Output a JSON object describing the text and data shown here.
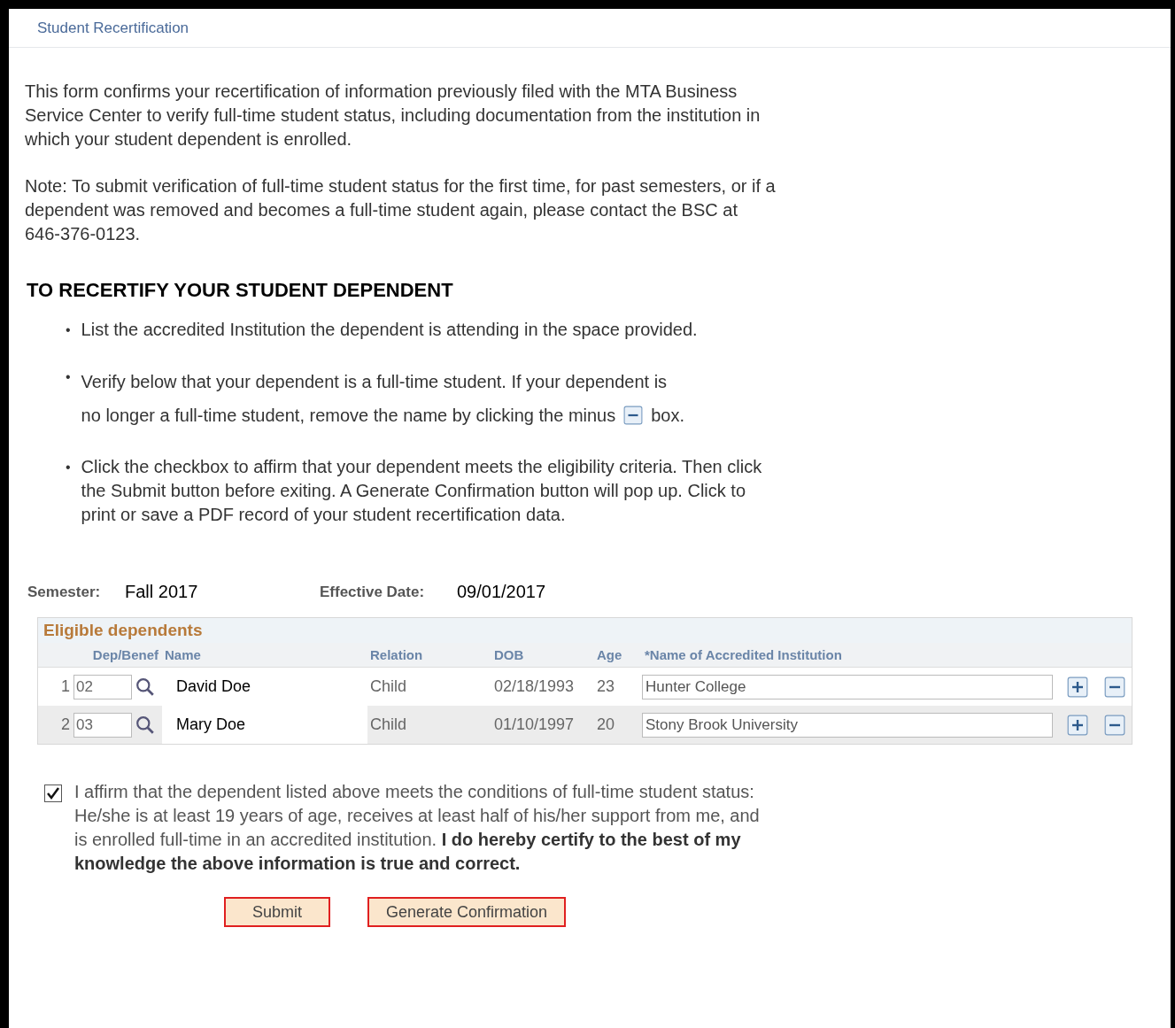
{
  "page_title": "Student Recertification",
  "intro": [
    "This form confirms your recertification of information previously filed with the MTA Business Service Center to verify full-time student status, including documentation from the institution in which your student dependent is enrolled.",
    "Note: To submit verification of full-time student status for the first time, for past semesters, or if a dependent was removed and becomes a full-time student again, please contact the BSC at 646-376-0123."
  ],
  "heading": "TO RECERTIFY YOUR STUDENT DEPENDENT",
  "bullets": [
    {
      "kind": "text",
      "marker": "•",
      "text": "List the accredited Institution the dependent is attending in the space provided."
    },
    {
      "kind": "icon",
      "marker": "•",
      "text": "Verify below that your dependent is a full-time student. If your dependent is",
      "text_2": "no longer a full-time student, remove the name by clicking the minus",
      "text_after": "box."
    },
    {
      "kind": "text",
      "marker": "•",
      "text": "Click the checkbox to affirm that your dependent meets the eligibility criteria. Then click the Submit button before exiting. A Generate Confirmation button will pop up. Click to print or save a PDF record of your student recertification data."
    }
  ],
  "semester": {
    "label": "Semester:",
    "value": "Fall 2017"
  },
  "effective_date": {
    "label": "Effective Date:",
    "value": "09/01/2017"
  },
  "table": {
    "title": "Eligible dependents",
    "columns": [
      "Dep/Benef",
      "Name",
      "Relation",
      "DOB",
      "Age",
      "*Name of Accredited Institution"
    ],
    "rows": [
      {
        "index": "1",
        "dep": "02",
        "name": "David Doe",
        "relation": "Child",
        "dob": "02/18/1993",
        "age": "23",
        "institution": "Hunter College"
      },
      {
        "index": "2",
        "dep": "03",
        "name": "Mary Doe",
        "relation": "Child",
        "dob": "01/10/1997",
        "age": "20",
        "institution": "Stony Brook University"
      }
    ]
  },
  "affirmation": {
    "checked": true,
    "text": "I affirm that the dependent listed above meets the conditions of full-time student status: He/she is at least 19 years of age, receives at least half of his/her support from me, and is enrolled full-time in an accredited institution. **I do hereby certify to the best of my knowledge the above information is true and correct.**"
  },
  "buttons": [
    "Submit",
    "Generate Confirmation"
  ]
}
